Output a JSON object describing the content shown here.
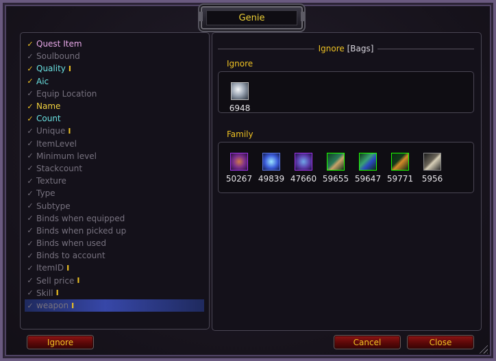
{
  "window": {
    "title": "Genie"
  },
  "list": {
    "items": [
      {
        "label": "Quest Item",
        "checked": true,
        "color": "pink",
        "bar": false
      },
      {
        "label": "Soulbound",
        "checked": false,
        "color": "gray",
        "bar": false
      },
      {
        "label": "Quality",
        "checked": true,
        "color": "cyan",
        "bar": true
      },
      {
        "label": "Aic",
        "checked": true,
        "color": "cyan",
        "bar": false
      },
      {
        "label": "Equip Location",
        "checked": false,
        "color": "gray",
        "bar": false
      },
      {
        "label": "Name",
        "checked": true,
        "color": "yellow",
        "bar": false
      },
      {
        "label": "Count",
        "checked": true,
        "color": "cyan",
        "bar": false
      },
      {
        "label": "Unique",
        "checked": false,
        "color": "gray",
        "bar": true
      },
      {
        "label": "ItemLevel",
        "checked": false,
        "color": "gray",
        "bar": false
      },
      {
        "label": "Minimum level",
        "checked": false,
        "color": "gray",
        "bar": false
      },
      {
        "label": "Stackcount",
        "checked": false,
        "color": "gray",
        "bar": false
      },
      {
        "label": "Texture",
        "checked": false,
        "color": "gray",
        "bar": false
      },
      {
        "label": "Type",
        "checked": false,
        "color": "gray",
        "bar": false
      },
      {
        "label": "Subtype",
        "checked": false,
        "color": "gray",
        "bar": false
      },
      {
        "label": "Binds when equipped",
        "checked": false,
        "color": "gray",
        "bar": false
      },
      {
        "label": "Binds when picked up",
        "checked": false,
        "color": "gray",
        "bar": false
      },
      {
        "label": "Binds when used",
        "checked": false,
        "color": "gray",
        "bar": false
      },
      {
        "label": "Binds to account",
        "checked": false,
        "color": "gray",
        "bar": false
      },
      {
        "label": "ItemID",
        "checked": false,
        "color": "gray",
        "bar": true
      },
      {
        "label": "Sell price",
        "checked": false,
        "color": "gray",
        "bar": true
      },
      {
        "label": "Skill",
        "checked": false,
        "color": "gray",
        "bar": true
      },
      {
        "label": "weapon",
        "checked": false,
        "color": "gray",
        "bar": true,
        "selected": true
      }
    ],
    "check_glyph": "✓",
    "bar_glyph": "I"
  },
  "right": {
    "header_title": "Ignore",
    "header_suffix": "[Bags]",
    "ignore_label": "Ignore",
    "ignore_items": [
      {
        "count": "6948",
        "icon": "hearthstone-icon"
      }
    ],
    "family_label": "Family",
    "family_items": [
      {
        "count": "50267",
        "icon": "epic-weapon-icon"
      },
      {
        "count": "49839",
        "icon": "rare-item-icon"
      },
      {
        "count": "47660",
        "icon": "epic-axe-icon"
      },
      {
        "count": "59655",
        "icon": "green-bow-icon"
      },
      {
        "count": "59647",
        "icon": "green-polearm-icon"
      },
      {
        "count": "59771",
        "icon": "green-sword-icon"
      },
      {
        "count": "5956",
        "icon": "hammer-icon"
      }
    ]
  },
  "buttons": {
    "ignore": "Ignore",
    "cancel": "Cancel",
    "close": "Close"
  },
  "colors": {
    "gold": "#f0c323",
    "pink": "#e7a8e8",
    "cyan": "#6ae1e1",
    "gray": "#77727f",
    "button_red": "#8a1414"
  }
}
